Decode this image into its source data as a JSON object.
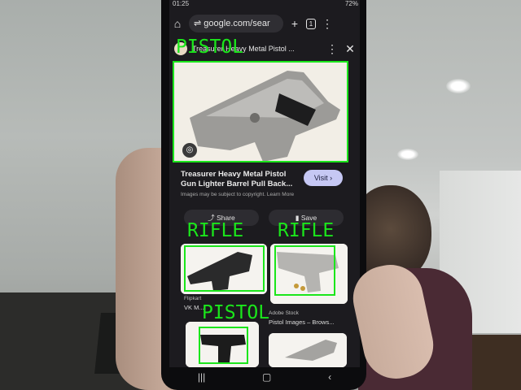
{
  "status_bar": {
    "time": "01:25",
    "battery": "72%"
  },
  "browser": {
    "url": "google.com/sear",
    "tab_count": "1"
  },
  "result": {
    "title": "Treasurer Heavy Metal Pistol ...",
    "caption": "Treasurer Heavy Metal Pistol Gun Lighter Barrel Pull Back...",
    "visit_label": "Visit",
    "copyright": "Images may be subject to copyright. Learn More",
    "share_label": "Share",
    "save_label": "Save"
  },
  "related": [
    {
      "source": "Flipkart",
      "title": "VK M..."
    },
    {
      "source": "Adobe Stock",
      "title": "Pistol Images – Brows..."
    }
  ],
  "detections": [
    {
      "label": "PISTOL"
    },
    {
      "label": "RIFLE"
    },
    {
      "label": "RIFLE"
    },
    {
      "label": "PISTOL"
    }
  ],
  "colors": {
    "detection": "#1be61b",
    "visit_button": "#c6c8f4"
  },
  "icons": [
    "home-icon",
    "site-settings-icon",
    "plus-icon",
    "tabs-icon",
    "menu-icon",
    "close-icon",
    "lens-icon",
    "share-icon",
    "save-icon"
  ]
}
